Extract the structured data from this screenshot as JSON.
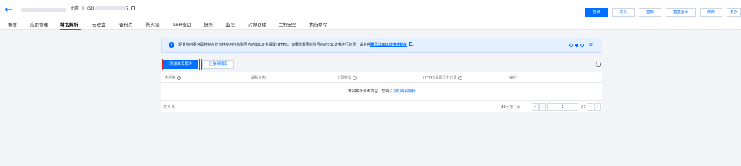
{
  "header": {
    "back_icon": "arrow-left-icon",
    "region_label": "北京",
    "separator": "|",
    "ip_prefix": "(公)",
    "ip_suffix": "7",
    "copy_icon": "copy-icon"
  },
  "actions": [
    {
      "label": "登录",
      "primary": true
    },
    {
      "label": "关机",
      "primary": false
    },
    {
      "label": "重启",
      "primary": false
    },
    {
      "label": "重置密码",
      "primary": false
    },
    {
      "label": "续费",
      "primary": false
    },
    {
      "label": "更多",
      "primary": false
    }
  ],
  "tabs": [
    {
      "label": "概要",
      "active": false
    },
    {
      "label": "应用管理",
      "active": false
    },
    {
      "label": "域名解析",
      "active": true
    },
    {
      "label": "云硬盘",
      "active": false
    },
    {
      "label": "备份点",
      "active": false
    },
    {
      "label": "防火墙",
      "active": false
    },
    {
      "label": "SSH密钥",
      "active": false
    },
    {
      "label": "快照",
      "active": false
    },
    {
      "label": "监控",
      "active": false
    },
    {
      "label": "对象存储",
      "active": false
    },
    {
      "label": "主机安全",
      "active": false
    },
    {
      "label": "执行命令",
      "active": false
    }
  ],
  "banner": {
    "icon": "info-icon",
    "text": "轻量应用服务器控制台仅支持使用当前账号内的SSL证书设置HTTPS。如果您需要对账号内的SSL证书进行管理，请前往",
    "link": "腾讯云SSL证书控制台",
    "tail": "。",
    "close": "✕",
    "accent_color": "#006eff"
  },
  "buttons": {
    "add_domain": "添加域名解析",
    "register_domain": "注册新域名",
    "refresh_icon": "refresh-icon"
  },
  "table": {
    "columns": [
      "主机名",
      "解析状态",
      "记录类型",
      "HTTPS设置历史记录",
      "操作"
    ],
    "empty_text": "域名解析列表为空，您可以",
    "empty_link": "添加域名解析"
  },
  "pagination": {
    "total": "共 0 条",
    "page_size": "20",
    "page_size_unit": "条 / 页",
    "current_page": "1",
    "total_pages": "/ 1 页"
  }
}
